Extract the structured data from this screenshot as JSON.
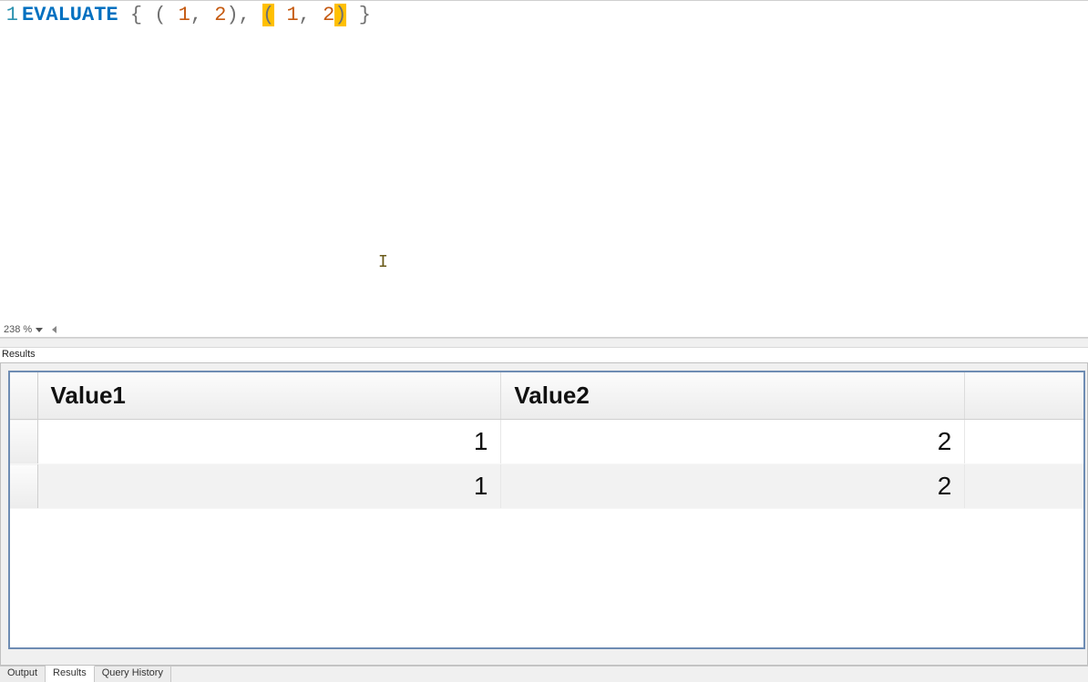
{
  "editor": {
    "line_number": "1",
    "zoom_label": "238 %",
    "tokens": [
      {
        "cls": "tok-keyword",
        "text": "EVALUATE"
      },
      {
        "cls": "",
        "text": " "
      },
      {
        "cls": "tok-punc",
        "text": "{"
      },
      {
        "cls": "",
        "text": " "
      },
      {
        "cls": "tok-punc",
        "text": "("
      },
      {
        "cls": "",
        "text": " "
      },
      {
        "cls": "tok-num",
        "text": "1"
      },
      {
        "cls": "tok-punc",
        "text": ","
      },
      {
        "cls": "",
        "text": " "
      },
      {
        "cls": "tok-num",
        "text": "2"
      },
      {
        "cls": "tok-punc",
        "text": ")"
      },
      {
        "cls": "tok-punc",
        "text": ","
      },
      {
        "cls": "",
        "text": " "
      },
      {
        "cls": "tok-punc tok-hl",
        "text": "("
      },
      {
        "cls": "",
        "text": " "
      },
      {
        "cls": "tok-num",
        "text": "1"
      },
      {
        "cls": "tok-punc",
        "text": ","
      },
      {
        "cls": "",
        "text": " "
      },
      {
        "cls": "tok-num",
        "text": "2"
      },
      {
        "cls": "tok-punc tok-hl",
        "text": ")"
      },
      {
        "cls": "",
        "text": " "
      },
      {
        "cls": "tok-punc",
        "text": "}"
      }
    ]
  },
  "results_header": "Results",
  "grid": {
    "columns": [
      "Value1",
      "Value2"
    ],
    "rows": [
      [
        "1",
        "2"
      ],
      [
        "1",
        "2"
      ]
    ]
  },
  "tabs": {
    "output": "Output",
    "results": "Results",
    "history": "Query History",
    "active": "results"
  }
}
